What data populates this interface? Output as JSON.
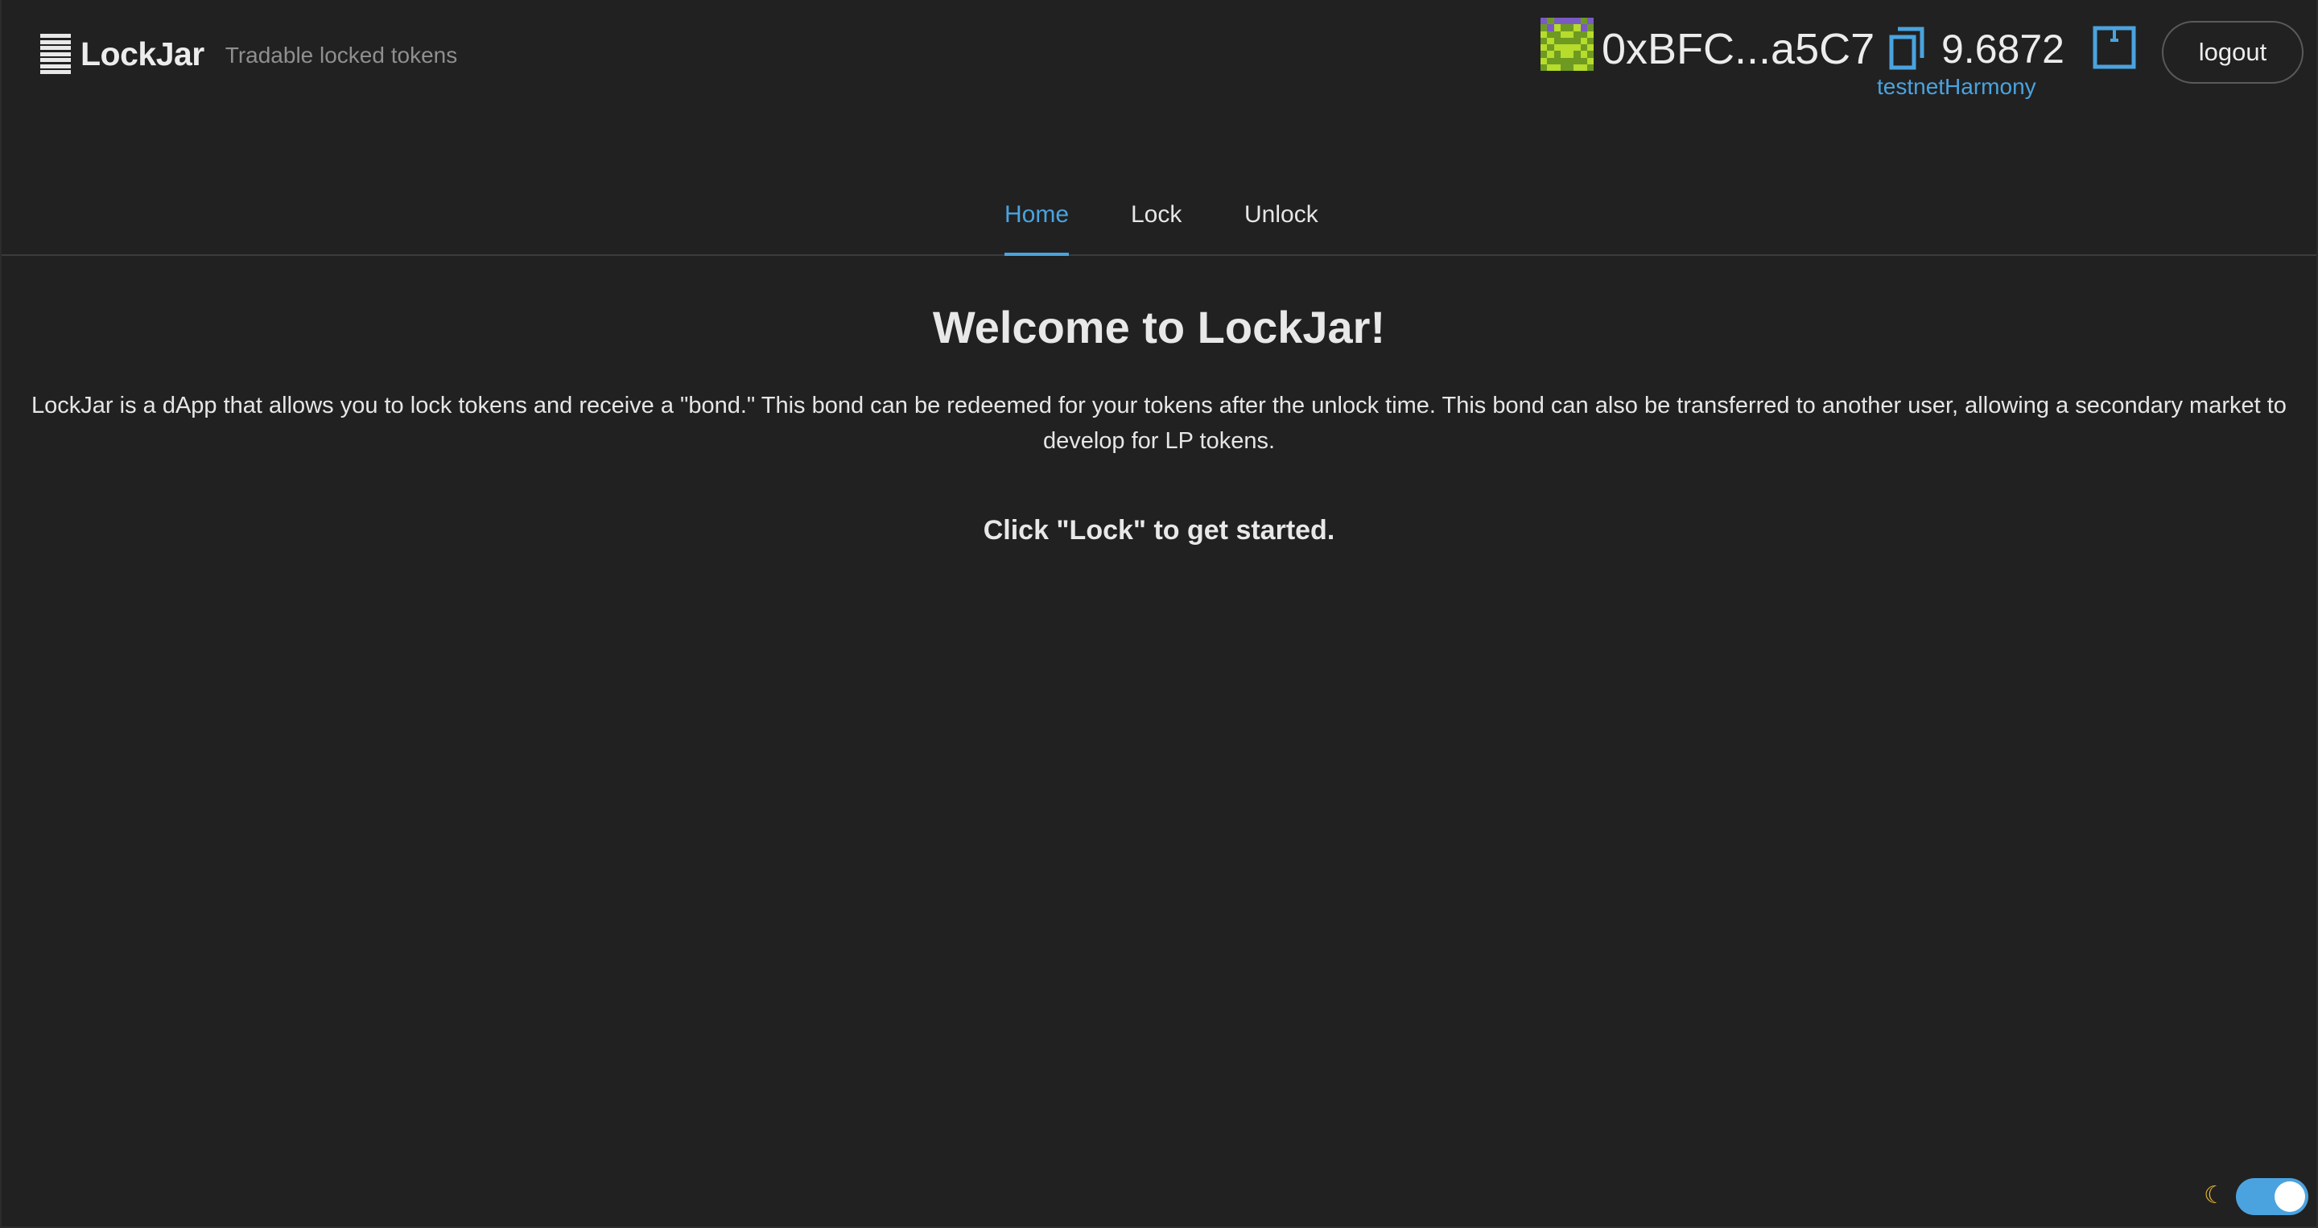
{
  "header": {
    "brand_name": "LockJar",
    "tagline": "Tradable locked tokens",
    "logo_icon": "lines-icon"
  },
  "account": {
    "address": "0xBFC...a5C7",
    "balance": "9.6872",
    "network": "testnetHarmony",
    "logout_label": "logout",
    "avatar": "blockie-avatar",
    "copy_icon": "copy-icon",
    "wallet_icon": "wallet-icon"
  },
  "tabs": [
    {
      "label": "Home",
      "active": true
    },
    {
      "label": "Lock",
      "active": false
    },
    {
      "label": "Unlock",
      "active": false
    }
  ],
  "main": {
    "title": "Welcome to LockJar!",
    "description": "LockJar is a dApp that allows you to lock tokens and receive a \"bond.\" This bond can be redeemed for your tokens after the unlock time. This bond can also be transferred to another user, allowing a secondary market to develop for LP tokens.",
    "cta": "Click \"Lock\" to get started."
  },
  "theme": {
    "mode": "dark",
    "toggle_on": true,
    "moon_icon": "moon-icon"
  },
  "colors": {
    "background": "#212121",
    "accent": "#4aa3df",
    "text": "#e6e6e6",
    "muted": "#8f8f8f"
  }
}
